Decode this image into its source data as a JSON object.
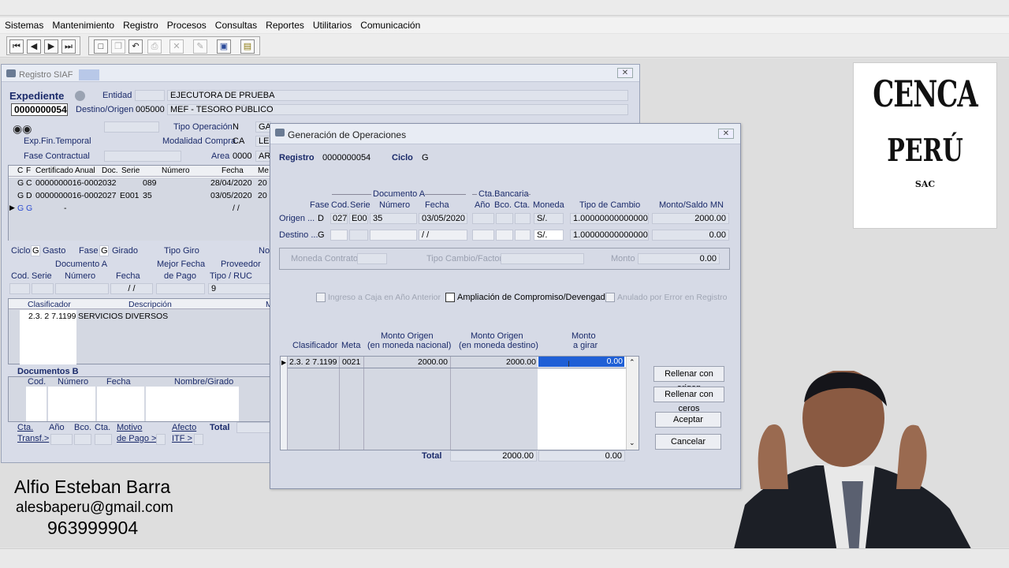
{
  "menu": [
    "Sistemas",
    "Mantenimiento",
    "Registro",
    "Procesos",
    "Consultas",
    "Reportes",
    "Utilitarios",
    "Comunicación"
  ],
  "registro": {
    "title": "Registro SIAF",
    "expediente_label": "Expediente",
    "expediente_value": "0000000054",
    "entidad_label": "Entidad",
    "entidad_value": "EJECUTORA DE PRUEBA",
    "destino_label": "Destino/Origen",
    "destino_code": "005000",
    "destino_value": "MEF - TESORO PÚBLICO",
    "tipo_operacion_label": "Tipo Operación",
    "tipo_operacion_value": "N",
    "tipo_operacion_text": "GA",
    "exp_fin_label": "Exp.Fin.Temporal",
    "modalidad_label": "Modalidad Compra",
    "modalidad_value": "CA",
    "modalidad_text": "LE",
    "fase_contractual_label": "Fase Contractual",
    "area_label": "Area",
    "area_value": "0000",
    "area_text": "AR",
    "grid_headers": [
      "C",
      "F",
      "Certificado Anual",
      "Doc.",
      "Serie",
      "Número",
      "Fecha",
      "Me"
    ],
    "grid_rows": [
      [
        "G",
        "C",
        "0000000016-0002",
        "032",
        "",
        "089",
        "28/04/2020",
        "20"
      ],
      [
        "G",
        "D",
        "0000000016-0002",
        "027",
        "E001",
        "35",
        "03/05/2020",
        "20"
      ],
      [
        "G",
        "G",
        "-",
        "",
        "",
        "",
        "/ /",
        ""
      ]
    ],
    "ciclo_label": "Ciclo",
    "ciclo_value": "G",
    "ciclo_text": "Gasto",
    "fase_label": "Fase",
    "fase_value": "G",
    "fase_text": "Girado",
    "tipo_giro_label": "Tipo Giro",
    "not_label": "Not",
    "docA_label": "Documento A",
    "cod_label": "Cod.",
    "serie_label": "Serie",
    "numero_label": "Número",
    "fecha_label": "Fecha",
    "mejor_fecha_label": "Mejor Fecha",
    "de_pago_label": "de Pago",
    "proveedor_label": "Proveedor",
    "tipo_ruc_label": "Tipo / RUC",
    "fecha_empty": "/ /",
    "tipo_ruc_value": "9",
    "clasificador_label": "Clasificador",
    "descripcion_label": "Descripción",
    "m_label": "M",
    "clasificador_value": "2.3. 2 7.1199",
    "descripcion_value": "SERVICIOS DIVERSOS",
    "docsB_label": "Documentos B",
    "nombre_label": "Nombre/Girado",
    "cta_label": "Cta.",
    "transf_label": "Transf.>",
    "ano_label": "Año",
    "bco_label": "Bco.",
    "motivo_label": "Motivo",
    "motivo_pago_label": "de Pago >",
    "afecto_label": "Afecto",
    "itf_label": "ITF >",
    "total_label": "Total"
  },
  "dialog": {
    "title": "Generación de Operaciones",
    "registro_label": "Registro",
    "registro_value": "0000000054",
    "ciclo_label": "Ciclo",
    "ciclo_value": "G",
    "doc_a_header": "Documento A",
    "cta_bancaria_header": "Cta.Bancaria",
    "headers": [
      "Fase",
      "Cod.",
      "Serie",
      "Número",
      "Fecha",
      "Año",
      "Bco.",
      "Cta.",
      "Moneda",
      "Tipo de Cambio",
      "Monto/Saldo MN"
    ],
    "origen_label": "Origen ...",
    "origen": {
      "fase": "D",
      "cod": "027",
      "serie": "E00'",
      "numero": "35",
      "fecha": "03/05/2020",
      "moneda": "S/.",
      "tipo_cambio": "1.000000000000000",
      "monto": "2000.00"
    },
    "destino_label": "Destino ...",
    "destino": {
      "fase": "G",
      "fecha": "/ /",
      "moneda": "S/.",
      "tipo_cambio": "1.000000000000000",
      "monto": "0.00"
    },
    "moneda_contrato_label": "Moneda Contrato",
    "tipo_cambio_factor_label": "Tipo Cambio/Factor",
    "monto_label": "Monto",
    "monto_value": "0.00",
    "chk_ingreso": "Ingreso a Caja en Año Anterior",
    "chk_ampliacion": "Ampliación de Compromiso/Devengado",
    "chk_anulado": "Anulado por Error en Registro",
    "grid_headers": {
      "clasificador": "Clasificador",
      "meta": "Meta",
      "monto_origen_1": "Monto Origen",
      "monto_origen_1b": "(en moneda nacional)",
      "monto_origen_2": "Monto Origen",
      "monto_origen_2b": "(en moneda destino)",
      "monto_girar_1": "Monto",
      "monto_girar_2": "a girar"
    },
    "row": {
      "clasificador": "2.3. 2 7.1199",
      "meta": "0021",
      "monto_mn": "2000.00",
      "monto_dest": "2000.00",
      "monto_girar": "0.00"
    },
    "total_label": "Total",
    "total_origen": "2000.00",
    "total_girar": "0.00",
    "btn_rellenar_origen": "Rellenar con origen",
    "btn_rellenar_ceros": "Rellenar con ceros",
    "btn_aceptar": "Aceptar",
    "btn_cancelar": "Cancelar"
  },
  "logo": {
    "line1": "CENCA",
    "line2": "PERÚ",
    "line3": "SAC"
  },
  "presenter": {
    "name": "Alfio Esteban Barra",
    "email": "alesbaperu@gmail.com",
    "phone": "963999904"
  }
}
